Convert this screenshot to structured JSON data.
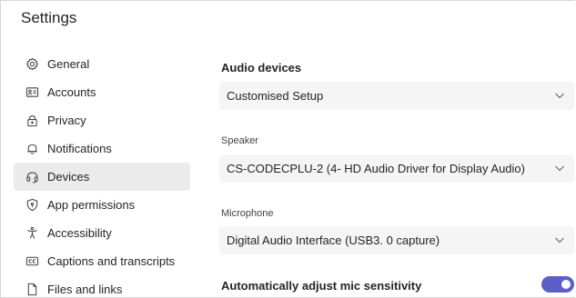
{
  "header": {
    "title": "Settings"
  },
  "sidebar": {
    "items": [
      {
        "label": "General",
        "icon": "gear-icon",
        "active": false
      },
      {
        "label": "Accounts",
        "icon": "id-card-icon",
        "active": false
      },
      {
        "label": "Privacy",
        "icon": "lock-icon",
        "active": false
      },
      {
        "label": "Notifications",
        "icon": "bell-icon",
        "active": false
      },
      {
        "label": "Devices",
        "icon": "headset-icon",
        "active": true
      },
      {
        "label": "App permissions",
        "icon": "shield-icon",
        "active": false
      },
      {
        "label": "Accessibility",
        "icon": "accessibility-icon",
        "active": false
      },
      {
        "label": "Captions and transcripts",
        "icon": "cc-icon",
        "active": false
      },
      {
        "label": "Files and links",
        "icon": "file-icon",
        "active": false
      }
    ]
  },
  "main": {
    "audio_devices": {
      "title": "Audio devices",
      "setup_value": "Customised Setup"
    },
    "speaker": {
      "label": "Speaker",
      "value": "CS-CODECPLU-2 (4- HD Audio Driver for Display Audio)"
    },
    "microphone": {
      "label": "Microphone",
      "value": "Digital Audio Interface (USB3. 0 capture)"
    },
    "auto_mic": {
      "label": "Automatically adjust mic sensitivity",
      "enabled": true
    }
  },
  "colors": {
    "accent": "#5b5fc7",
    "active_bg": "#ebebeb",
    "dropdown_bg": "#f5f5f5"
  }
}
